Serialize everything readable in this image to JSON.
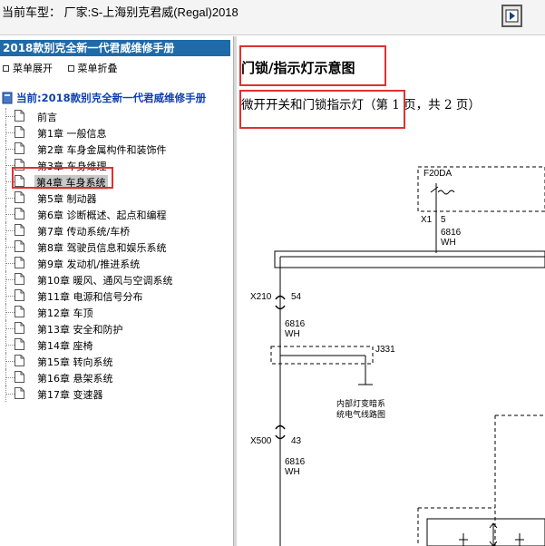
{
  "header": {
    "car_model": "当前车型： 厂家:S-上海别克君威(Regal)2018",
    "nav_button_icon": "navigate-icon"
  },
  "sidebar": {
    "manual_title": "2018款别克全新一代君威维修手册",
    "expand_label": "菜单展开",
    "collapse_label": "菜单折叠",
    "current_label": "当前:2018款别克全新一代君威维修手册",
    "items": [
      {
        "label": "前言"
      },
      {
        "label": "第1章 一般信息"
      },
      {
        "label": "第2章 车身金属构件和装饰件"
      },
      {
        "label": "第3章 车身维理"
      },
      {
        "label": "第4章 车身系统"
      },
      {
        "label": "第5章 制动器"
      },
      {
        "label": "第6章 诊断概述、起点和编程"
      },
      {
        "label": "第7章 传动系统/车桥"
      },
      {
        "label": "第8章 驾驶员信息和娱乐系统"
      },
      {
        "label": "第9章 发动机/推进系统"
      },
      {
        "label": "第10章 暖风、通风与空调系统"
      },
      {
        "label": "第11章 电源和信号分布"
      },
      {
        "label": "第12章 车顶"
      },
      {
        "label": "第13章 安全和防护"
      },
      {
        "label": "第14章 座椅"
      },
      {
        "label": "第15章 转向系统"
      },
      {
        "label": "第16章 悬架系统"
      },
      {
        "label": "第17章 变速器"
      }
    ],
    "selected_index": 4
  },
  "content": {
    "title": "门锁/指示灯示意图",
    "subtitle": "微开开关和门锁指示灯（第 1 页，共 2 页）",
    "diagram": {
      "fuse_label": "F20DA",
      "x1_label": "X1",
      "x1_pin": "5",
      "wire_1_code": "6816",
      "wire_1_color": "WH",
      "x210_label": "X210",
      "x210_pin": "54",
      "wire_2_code": "6816",
      "wire_2_color": "WH",
      "j331_label": "J331",
      "ref_line1": "内部灯变暗系",
      "ref_line2": "统电气线路图",
      "x500_label": "X500",
      "x500_pin": "43",
      "wire_3_code": "6816",
      "wire_3_color": "WH"
    }
  }
}
